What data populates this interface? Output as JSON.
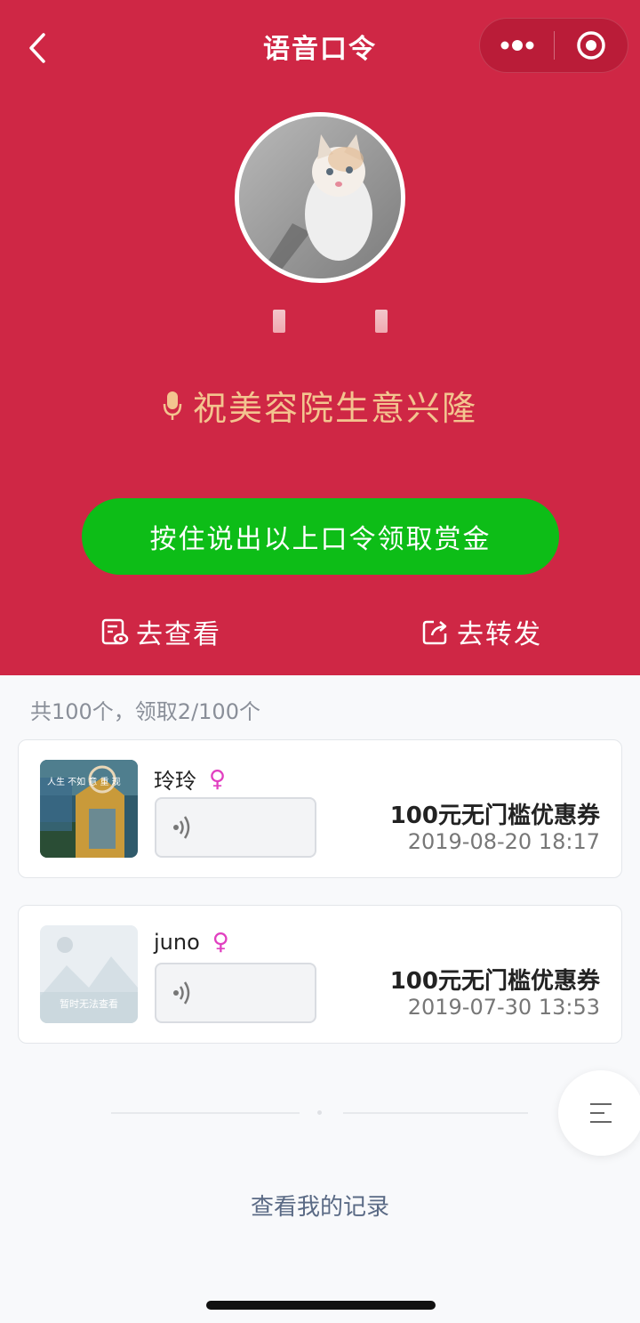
{
  "nav": {
    "title": "语音口令",
    "back_icon": "chevron-left-icon",
    "more_icon": "more-dots-icon",
    "close_icon": "target-circle-icon"
  },
  "header": {
    "avatar": "kitten-photo",
    "phrase": "祝美容院生意兴隆",
    "phrase_icon": "microphone-icon",
    "action_button": "按住说出以上口令领取赏金",
    "view_label": "去查看",
    "share_label": "去转发"
  },
  "list": {
    "summary": "共100个，领取2/100个",
    "items": [
      {
        "name": "玲玲",
        "gender": "♀",
        "prize": "100元无门槛优惠券",
        "date": "2019-08-20 18:17",
        "thumb_text": "人生 不如 意 重 现"
      },
      {
        "name": "juno",
        "gender": "♀",
        "prize": "100元无门槛优惠券",
        "date": "2019-07-30 13:53",
        "thumb_text": "暂时无法查看"
      }
    ]
  },
  "footer": {
    "records_link": "查看我的记录",
    "menu_icon": "menu-lines-icon"
  },
  "colors": {
    "hero": "#cf2745",
    "phrase": "#f3c48f",
    "green": "#0dbd17",
    "gender": "#e13fc0"
  }
}
